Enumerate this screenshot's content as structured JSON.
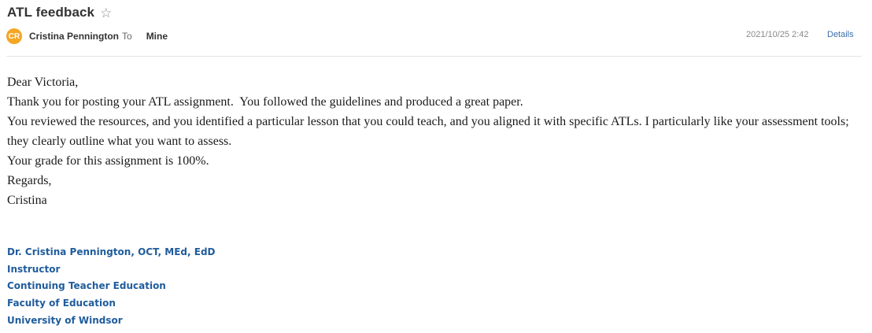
{
  "email": {
    "subject": "ATL feedback",
    "star_icon": "star-outline-icon",
    "avatar_initials": "CR",
    "avatar_color": "#f5a623",
    "sender": "Cristina Pennington",
    "to_label": "To",
    "recipient": "Mine",
    "date": "2021/10/25 2:42",
    "details_label": "Details"
  },
  "body": {
    "lines": [
      "Dear Victoria,",
      "Thank you for posting your ATL assignment.  You followed the guidelines and produced a great paper.",
      "You reviewed the resources, and you identified a particular lesson that you could teach, and you aligned it with specific ATLs. I particularly like your assessment tools; they clearly outline what you want to assess.",
      "Your grade for this assignment is 100%.",
      "Regards,",
      "Cristina"
    ]
  },
  "signature": {
    "color": "#1f5c9c",
    "lines": [
      "Dr. Cristina Pennington, OCT, MEd, EdD",
      "Instructor",
      "Continuing Teacher Education",
      "Faculty of Education",
      "University of Windsor"
    ]
  }
}
